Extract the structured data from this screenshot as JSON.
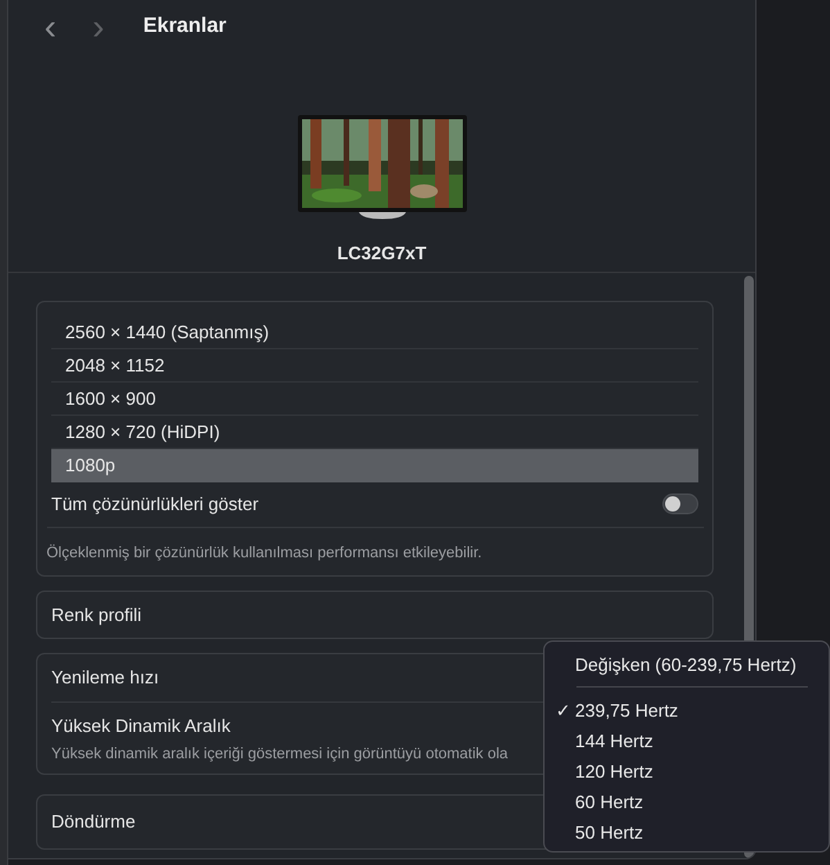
{
  "header": {
    "back": "‹",
    "forward": "›",
    "title": "Ekranlar"
  },
  "display": {
    "name": "LC32G7xT"
  },
  "resolutions": [
    {
      "label": "2560 × 1440 (Saptanmış)",
      "selected": false
    },
    {
      "label": "2048 × 1152",
      "selected": false
    },
    {
      "label": "1600 × 900",
      "selected": false
    },
    {
      "label": "1280 × 720 (HiDPI)",
      "selected": false
    },
    {
      "label": "1080p",
      "selected": true
    }
  ],
  "show_all": {
    "label": "Tüm çözünürlükleri göster",
    "on": false
  },
  "note": "Ölçeklenmiş bir çözünürlük kullanılması performansı etkileyebilir.",
  "color_profile": {
    "label": "Renk profili"
  },
  "refresh": {
    "label": "Yenileme hızı"
  },
  "hdr": {
    "label": "Yüksek Dinamik Aralık",
    "description": "Yüksek dinamik aralık içeriği göstermesi için görüntüyü otomatik ola"
  },
  "rotation": {
    "label": "Döndürme"
  },
  "refresh_menu": {
    "check": "✓",
    "header": "Değişken (60-239,75 Hertz)",
    "items": [
      {
        "label": "239,75 Hertz",
        "selected": true
      },
      {
        "label": "144 Hertz",
        "selected": false
      },
      {
        "label": "120 Hertz",
        "selected": false
      },
      {
        "label": "60 Hertz",
        "selected": false
      },
      {
        "label": "50 Hertz",
        "selected": false
      }
    ]
  }
}
